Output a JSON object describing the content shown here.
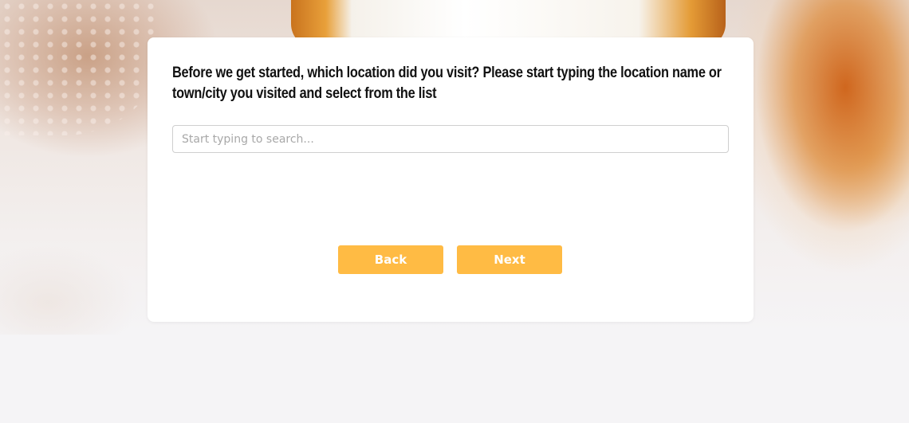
{
  "survey": {
    "question": "Before we get started, which location did you visit? Please start typing the location name or town/city you visited and select from the list",
    "search": {
      "placeholder": "Start typing to search...",
      "value": ""
    },
    "back_label": "Back",
    "next_label": "Next"
  },
  "colors": {
    "button": "#ffbb44",
    "button_text": "#ffffff",
    "card": "#ffffff",
    "page": "#f5f4f6"
  }
}
